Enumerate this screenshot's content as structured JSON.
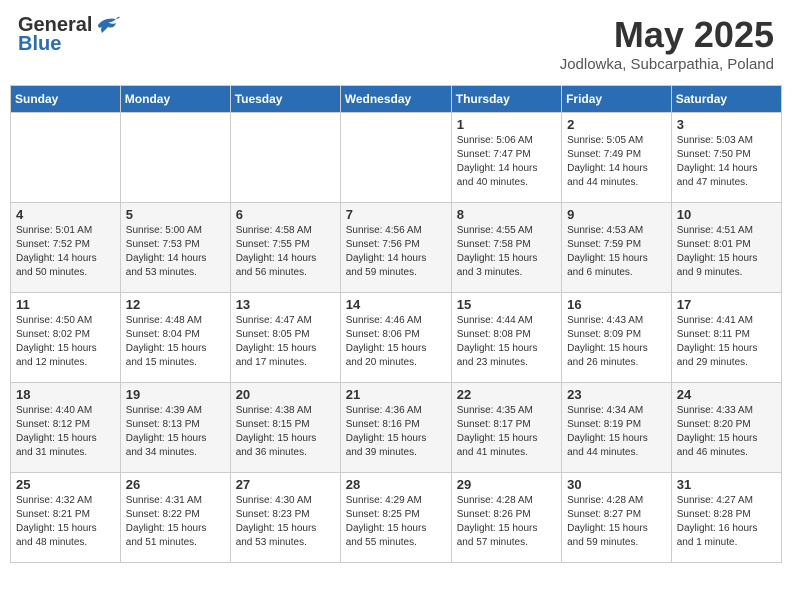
{
  "header": {
    "logo_general": "General",
    "logo_blue": "Blue",
    "month_title": "May 2025",
    "location": "Jodlowka, Subcarpathia, Poland"
  },
  "weekdays": [
    "Sunday",
    "Monday",
    "Tuesday",
    "Wednesday",
    "Thursday",
    "Friday",
    "Saturday"
  ],
  "weeks": [
    [
      {
        "day": "",
        "info": ""
      },
      {
        "day": "",
        "info": ""
      },
      {
        "day": "",
        "info": ""
      },
      {
        "day": "",
        "info": ""
      },
      {
        "day": "1",
        "info": "Sunrise: 5:06 AM\nSunset: 7:47 PM\nDaylight: 14 hours\nand 40 minutes."
      },
      {
        "day": "2",
        "info": "Sunrise: 5:05 AM\nSunset: 7:49 PM\nDaylight: 14 hours\nand 44 minutes."
      },
      {
        "day": "3",
        "info": "Sunrise: 5:03 AM\nSunset: 7:50 PM\nDaylight: 14 hours\nand 47 minutes."
      }
    ],
    [
      {
        "day": "4",
        "info": "Sunrise: 5:01 AM\nSunset: 7:52 PM\nDaylight: 14 hours\nand 50 minutes."
      },
      {
        "day": "5",
        "info": "Sunrise: 5:00 AM\nSunset: 7:53 PM\nDaylight: 14 hours\nand 53 minutes."
      },
      {
        "day": "6",
        "info": "Sunrise: 4:58 AM\nSunset: 7:55 PM\nDaylight: 14 hours\nand 56 minutes."
      },
      {
        "day": "7",
        "info": "Sunrise: 4:56 AM\nSunset: 7:56 PM\nDaylight: 14 hours\nand 59 minutes."
      },
      {
        "day": "8",
        "info": "Sunrise: 4:55 AM\nSunset: 7:58 PM\nDaylight: 15 hours\nand 3 minutes."
      },
      {
        "day": "9",
        "info": "Sunrise: 4:53 AM\nSunset: 7:59 PM\nDaylight: 15 hours\nand 6 minutes."
      },
      {
        "day": "10",
        "info": "Sunrise: 4:51 AM\nSunset: 8:01 PM\nDaylight: 15 hours\nand 9 minutes."
      }
    ],
    [
      {
        "day": "11",
        "info": "Sunrise: 4:50 AM\nSunset: 8:02 PM\nDaylight: 15 hours\nand 12 minutes."
      },
      {
        "day": "12",
        "info": "Sunrise: 4:48 AM\nSunset: 8:04 PM\nDaylight: 15 hours\nand 15 minutes."
      },
      {
        "day": "13",
        "info": "Sunrise: 4:47 AM\nSunset: 8:05 PM\nDaylight: 15 hours\nand 17 minutes."
      },
      {
        "day": "14",
        "info": "Sunrise: 4:46 AM\nSunset: 8:06 PM\nDaylight: 15 hours\nand 20 minutes."
      },
      {
        "day": "15",
        "info": "Sunrise: 4:44 AM\nSunset: 8:08 PM\nDaylight: 15 hours\nand 23 minutes."
      },
      {
        "day": "16",
        "info": "Sunrise: 4:43 AM\nSunset: 8:09 PM\nDaylight: 15 hours\nand 26 minutes."
      },
      {
        "day": "17",
        "info": "Sunrise: 4:41 AM\nSunset: 8:11 PM\nDaylight: 15 hours\nand 29 minutes."
      }
    ],
    [
      {
        "day": "18",
        "info": "Sunrise: 4:40 AM\nSunset: 8:12 PM\nDaylight: 15 hours\nand 31 minutes."
      },
      {
        "day": "19",
        "info": "Sunrise: 4:39 AM\nSunset: 8:13 PM\nDaylight: 15 hours\nand 34 minutes."
      },
      {
        "day": "20",
        "info": "Sunrise: 4:38 AM\nSunset: 8:15 PM\nDaylight: 15 hours\nand 36 minutes."
      },
      {
        "day": "21",
        "info": "Sunrise: 4:36 AM\nSunset: 8:16 PM\nDaylight: 15 hours\nand 39 minutes."
      },
      {
        "day": "22",
        "info": "Sunrise: 4:35 AM\nSunset: 8:17 PM\nDaylight: 15 hours\nand 41 minutes."
      },
      {
        "day": "23",
        "info": "Sunrise: 4:34 AM\nSunset: 8:19 PM\nDaylight: 15 hours\nand 44 minutes."
      },
      {
        "day": "24",
        "info": "Sunrise: 4:33 AM\nSunset: 8:20 PM\nDaylight: 15 hours\nand 46 minutes."
      }
    ],
    [
      {
        "day": "25",
        "info": "Sunrise: 4:32 AM\nSunset: 8:21 PM\nDaylight: 15 hours\nand 48 minutes."
      },
      {
        "day": "26",
        "info": "Sunrise: 4:31 AM\nSunset: 8:22 PM\nDaylight: 15 hours\nand 51 minutes."
      },
      {
        "day": "27",
        "info": "Sunrise: 4:30 AM\nSunset: 8:23 PM\nDaylight: 15 hours\nand 53 minutes."
      },
      {
        "day": "28",
        "info": "Sunrise: 4:29 AM\nSunset: 8:25 PM\nDaylight: 15 hours\nand 55 minutes."
      },
      {
        "day": "29",
        "info": "Sunrise: 4:28 AM\nSunset: 8:26 PM\nDaylight: 15 hours\nand 57 minutes."
      },
      {
        "day": "30",
        "info": "Sunrise: 4:28 AM\nSunset: 8:27 PM\nDaylight: 15 hours\nand 59 minutes."
      },
      {
        "day": "31",
        "info": "Sunrise: 4:27 AM\nSunset: 8:28 PM\nDaylight: 16 hours\nand 1 minute."
      }
    ]
  ]
}
